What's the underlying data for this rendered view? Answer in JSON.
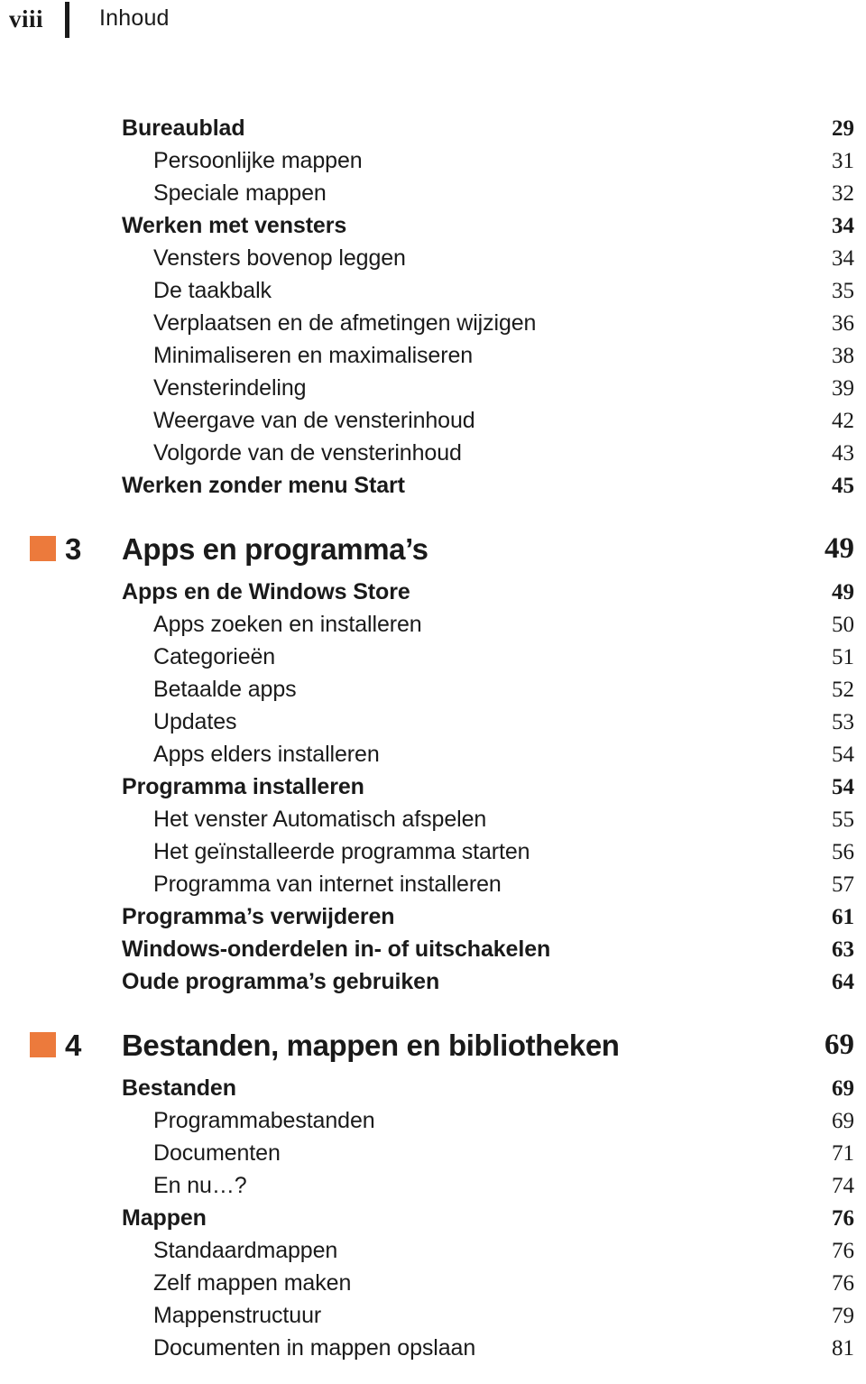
{
  "header": {
    "folio": "viii",
    "title": "Inhoud"
  },
  "accent_color": "#ec7a3c",
  "text_color": "#1a1a1a",
  "entries": [
    {
      "type": "level1",
      "label": "Bureaublad",
      "page": "29"
    },
    {
      "type": "level2",
      "label": "Persoonlijke mappen",
      "page": "31"
    },
    {
      "type": "level2",
      "label": "Speciale mappen",
      "page": "32"
    },
    {
      "type": "level1",
      "label": "Werken met vensters",
      "page": "34"
    },
    {
      "type": "level2",
      "label": "Vensters bovenop leggen",
      "page": "34"
    },
    {
      "type": "level2",
      "label": "De taakbalk",
      "page": "35"
    },
    {
      "type": "level2",
      "label": "Verplaatsen en de afmetingen wijzigen",
      "page": "36"
    },
    {
      "type": "level2",
      "label": "Minimaliseren en maximaliseren",
      "page": "38"
    },
    {
      "type": "level2",
      "label": "Vensterindeling",
      "page": "39"
    },
    {
      "type": "level2",
      "label": "Weergave van de vensterinhoud",
      "page": "42"
    },
    {
      "type": "level2",
      "label": "Volgorde van de vensterinhoud",
      "page": "43"
    },
    {
      "type": "level1",
      "label": "Werken zonder menu Start",
      "page": "45"
    },
    {
      "type": "chapter",
      "number": "3",
      "label": "Apps en programma’s",
      "page": "49"
    },
    {
      "type": "level1",
      "label": "Apps en de Windows Store",
      "page": "49"
    },
    {
      "type": "level2",
      "label": "Apps zoeken en installeren",
      "page": "50"
    },
    {
      "type": "level2",
      "label": "Categorieën",
      "page": "51"
    },
    {
      "type": "level2",
      "label": "Betaalde apps",
      "page": "52"
    },
    {
      "type": "level2",
      "label": "Updates",
      "page": "53"
    },
    {
      "type": "level2",
      "label": "Apps elders installeren",
      "page": "54"
    },
    {
      "type": "level1",
      "label": "Programma installeren",
      "page": "54"
    },
    {
      "type": "level2",
      "label": "Het venster Automatisch afspelen",
      "page": "55"
    },
    {
      "type": "level2",
      "label": "Het geïnstalleerde programma starten",
      "page": "56"
    },
    {
      "type": "level2",
      "label": "Programma van internet installeren",
      "page": "57"
    },
    {
      "type": "level1",
      "label": "Programma’s verwijderen",
      "page": "61"
    },
    {
      "type": "level1",
      "label": "Windows-onderdelen in- of uitschakelen",
      "page": "63"
    },
    {
      "type": "level1",
      "label": "Oude programma’s gebruiken",
      "page": "64"
    },
    {
      "type": "chapter",
      "number": "4",
      "label": "Bestanden, mappen en bibliotheken",
      "page": "69"
    },
    {
      "type": "level1",
      "label": "Bestanden",
      "page": "69"
    },
    {
      "type": "level2",
      "label": "Programmabestanden",
      "page": "69"
    },
    {
      "type": "level2",
      "label": "Documenten",
      "page": "71"
    },
    {
      "type": "level2",
      "label": "En nu…?",
      "page": "74"
    },
    {
      "type": "level1",
      "label": "Mappen",
      "page": "76"
    },
    {
      "type": "level2",
      "label": "Standaardmappen",
      "page": "76"
    },
    {
      "type": "level2",
      "label": "Zelf mappen maken",
      "page": "76"
    },
    {
      "type": "level2",
      "label": "Mappenstructuur",
      "page": "79"
    },
    {
      "type": "level2",
      "label": "Documenten in mappen opslaan",
      "page": "81"
    }
  ]
}
